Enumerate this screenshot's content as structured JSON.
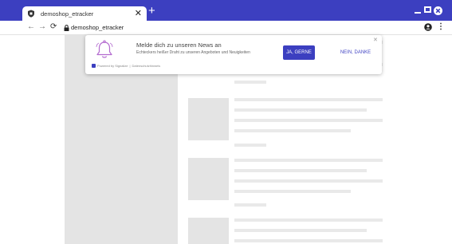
{
  "browser": {
    "tab": {
      "title": "demoshop_etracker",
      "close_label": "✕"
    },
    "new_tab_label": "+",
    "url": "demoshop_etracker",
    "nav": {
      "back": "←",
      "forward": "→",
      "reload": "⟳"
    },
    "menu_label": "⋮"
  },
  "popup": {
    "title": "Melde dich zu unseren News an",
    "description": "Echteckers heißer Draht zu unseren Angeboten und Neuigkeiten",
    "accept_label": "JA, GERNE",
    "decline_label": "NEIN, DANKE",
    "close_label": "✕",
    "footer": {
      "powered_by": "Powered by Signalize",
      "separator": "|",
      "privacy_link": "Datenschutzhinweis"
    }
  },
  "colors": {
    "brand": "#3c3fc0",
    "placeholder": "#e4e4e4",
    "bell": "#b36bcf"
  },
  "icons": {
    "tab_favicon": "shield-icon",
    "lock": "lock-icon",
    "profile": "account-circle-icon",
    "bell": "bell-icon"
  }
}
